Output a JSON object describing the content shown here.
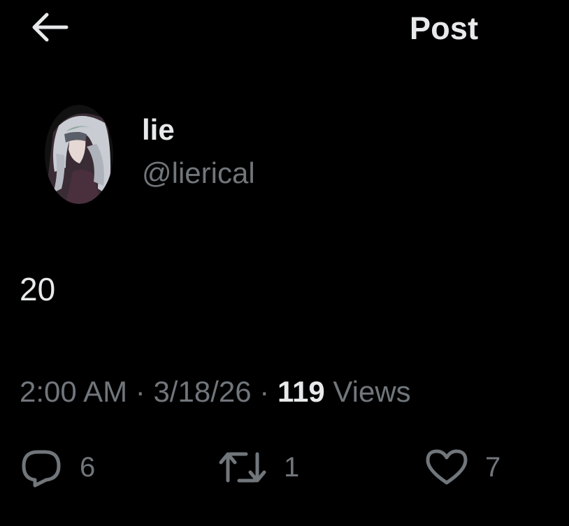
{
  "header": {
    "title": "Post",
    "back_icon": "arrow-left-icon"
  },
  "author": {
    "display_name": "lie",
    "handle": "@lierical",
    "avatar_icon": "avatar-image"
  },
  "post": {
    "text": "20"
  },
  "meta": {
    "time": "2:00 AM",
    "separator": "·",
    "date": "3/18/26",
    "views_count": "119",
    "views_label": "Views"
  },
  "actions": {
    "reply": {
      "icon": "reply-icon",
      "count": "6"
    },
    "repost": {
      "icon": "repost-icon",
      "count": "1"
    },
    "like": {
      "icon": "heart-icon",
      "count": "7"
    }
  },
  "colors": {
    "background": "#000000",
    "text_primary": "#e7e9ea",
    "text_secondary": "#71767b"
  }
}
